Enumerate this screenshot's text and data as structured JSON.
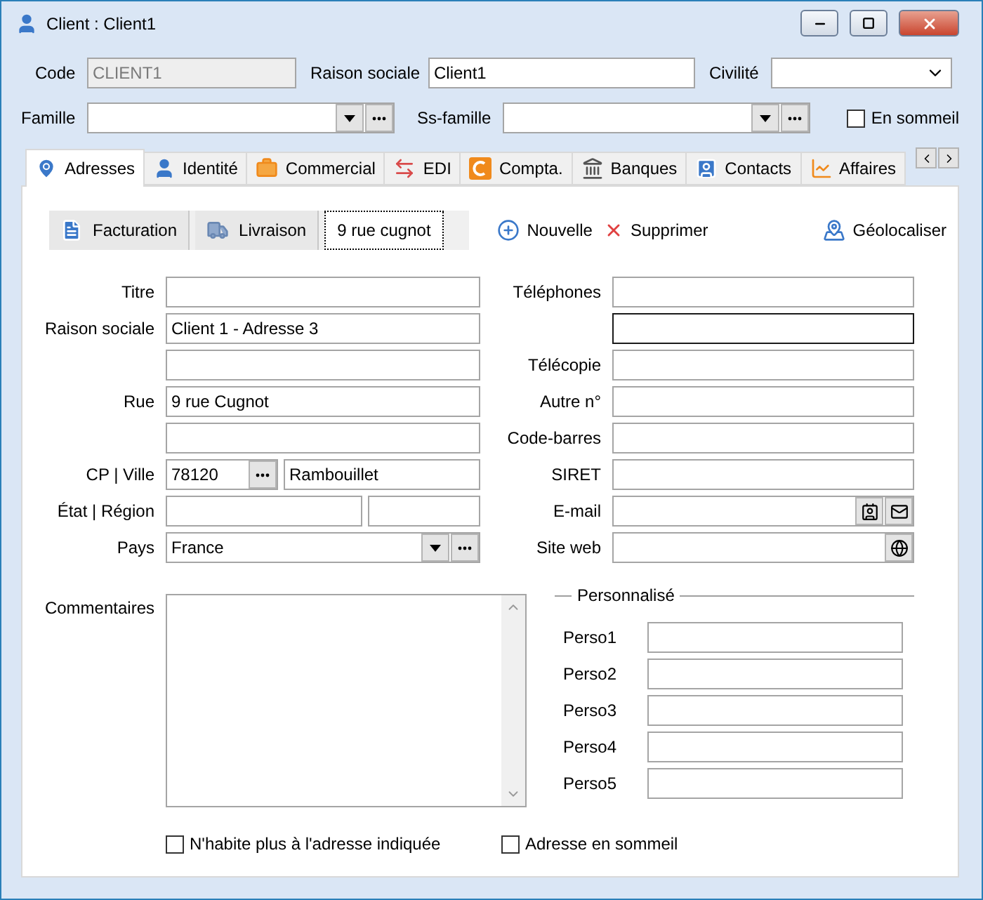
{
  "window": {
    "title": "Client : Client1"
  },
  "header": {
    "code": {
      "label": "Code",
      "value": "CLIENT1",
      "disabled": true
    },
    "raison_sociale": {
      "label": "Raison sociale",
      "value": "Client1"
    },
    "civilite": {
      "label": "Civilité"
    },
    "famille": {
      "label": "Famille"
    },
    "ss_famille": {
      "label": "Ss-famille"
    },
    "en_sommeil": {
      "label": "En sommeil",
      "checked": false
    }
  },
  "tabs": [
    {
      "label": "Adresses",
      "selected": true
    },
    {
      "label": "Identité",
      "selected": false
    },
    {
      "label": "Commercial",
      "selected": false
    },
    {
      "label": "EDI",
      "selected": false
    },
    {
      "label": "Compta.",
      "selected": false
    },
    {
      "label": "Banques",
      "selected": false
    },
    {
      "label": "Contacts",
      "selected": false
    },
    {
      "label": "Affaires",
      "selected": false
    }
  ],
  "address_tabs": [
    {
      "label": "Facturation",
      "selected": false
    },
    {
      "label": "Livraison",
      "selected": false
    },
    {
      "label": "9 rue cugnot",
      "selected": true
    }
  ],
  "actions": [
    {
      "label": "Nouvelle"
    },
    {
      "label": "Supprimer"
    },
    {
      "label": "Géolocaliser"
    }
  ],
  "left_fields": [
    {
      "kind": "text",
      "label": "Titre"
    },
    {
      "kind": "text",
      "label": "Raison sociale",
      "value": "Client 1 - Adresse 3"
    },
    {
      "kind": "text"
    },
    {
      "kind": "text",
      "label": "Rue",
      "value": "9 rue Cugnot"
    },
    {
      "kind": "text"
    },
    {
      "kind": "city",
      "label": "CP | Ville",
      "value": "78120",
      "value2": "Rambouillet"
    },
    {
      "kind": "split",
      "label": "État | Région"
    },
    {
      "kind": "select",
      "label": "Pays",
      "value": "France"
    }
  ],
  "right_fields": [
    {
      "kind": "text",
      "label": "Téléphones",
      "focused": false
    },
    {
      "kind": "text",
      "focused": true
    },
    {
      "kind": "text",
      "label": "Télécopie",
      "focused": false
    },
    {
      "kind": "text",
      "label": "Autre n°",
      "focused": false
    },
    {
      "kind": "text",
      "label": "Code-barres",
      "focused": false
    },
    {
      "kind": "text",
      "label": "SIRET",
      "focused": false
    },
    {
      "kind": "email",
      "label": "E-mail",
      "focused": false
    },
    {
      "kind": "web",
      "label": "Site web",
      "focused": false
    }
  ],
  "comments": {
    "label": "Commentaires"
  },
  "custom": {
    "title": "Personnalisé",
    "fields": [
      {
        "label": "Perso1"
      },
      {
        "label": "Perso2"
      },
      {
        "label": "Perso3"
      },
      {
        "label": "Perso4"
      },
      {
        "label": "Perso5"
      }
    ]
  },
  "checkboxes": [
    {
      "label": "N'habite plus à l'adresse indiquée",
      "checked": false
    },
    {
      "label": "Adresse en sommeil",
      "checked": false
    }
  ]
}
